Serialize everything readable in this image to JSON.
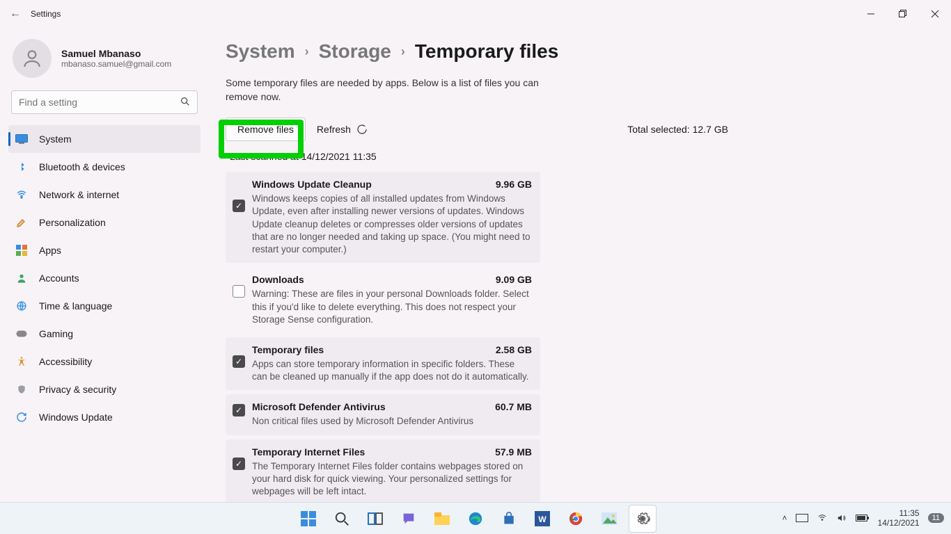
{
  "titlebar": {
    "title": "Settings"
  },
  "account": {
    "name": "Samuel Mbanaso",
    "email": "mbanaso.samuel@gmail.com"
  },
  "search": {
    "placeholder": "Find a setting"
  },
  "sidebar": {
    "items": [
      {
        "label": "System"
      },
      {
        "label": "Bluetooth & devices"
      },
      {
        "label": "Network & internet"
      },
      {
        "label": "Personalization"
      },
      {
        "label": "Apps"
      },
      {
        "label": "Accounts"
      },
      {
        "label": "Time & language"
      },
      {
        "label": "Gaming"
      },
      {
        "label": "Accessibility"
      },
      {
        "label": "Privacy & security"
      },
      {
        "label": "Windows Update"
      }
    ]
  },
  "breadcrumb": {
    "system": "System",
    "storage": "Storage",
    "page": "Temporary files"
  },
  "description": "Some temporary files are needed by apps. Below is a list of files you can remove now.",
  "actions": {
    "remove": "Remove files",
    "refresh": "Refresh",
    "total_label": "Total selected:",
    "total_value": "12.7 GB",
    "last_scanned": "Last scanned at 14/12/2021 11:35"
  },
  "items": [
    {
      "title": "Windows Update Cleanup",
      "size": "9.96 GB",
      "checked": true,
      "desc": "Windows keeps copies of all installed updates from Windows Update, even after installing newer versions of updates. Windows Update cleanup deletes or compresses older versions of updates that are no longer needed and taking up space. (You might need to restart your computer.)"
    },
    {
      "title": "Downloads",
      "size": "9.09 GB",
      "checked": false,
      "desc": "Warning: These are files in your personal Downloads folder. Select this if you'd like to delete everything. This does not respect your Storage Sense configuration."
    },
    {
      "title": "Temporary files",
      "size": "2.58 GB",
      "checked": true,
      "desc": "Apps can store temporary information in specific folders. These can be cleaned up manually if the app does not do it automatically."
    },
    {
      "title": "Microsoft Defender Antivirus",
      "size": "60.7 MB",
      "checked": true,
      "desc": "Non critical files used by Microsoft Defender Antivirus"
    },
    {
      "title": "Temporary Internet Files",
      "size": "57.9 MB",
      "checked": true,
      "desc": "The Temporary Internet Files folder contains webpages stored on your hard disk for quick viewing. Your personalized settings for webpages will be left intact."
    }
  ],
  "tray": {
    "time": "11:35",
    "date": "14/12/2021",
    "badge": "11"
  }
}
